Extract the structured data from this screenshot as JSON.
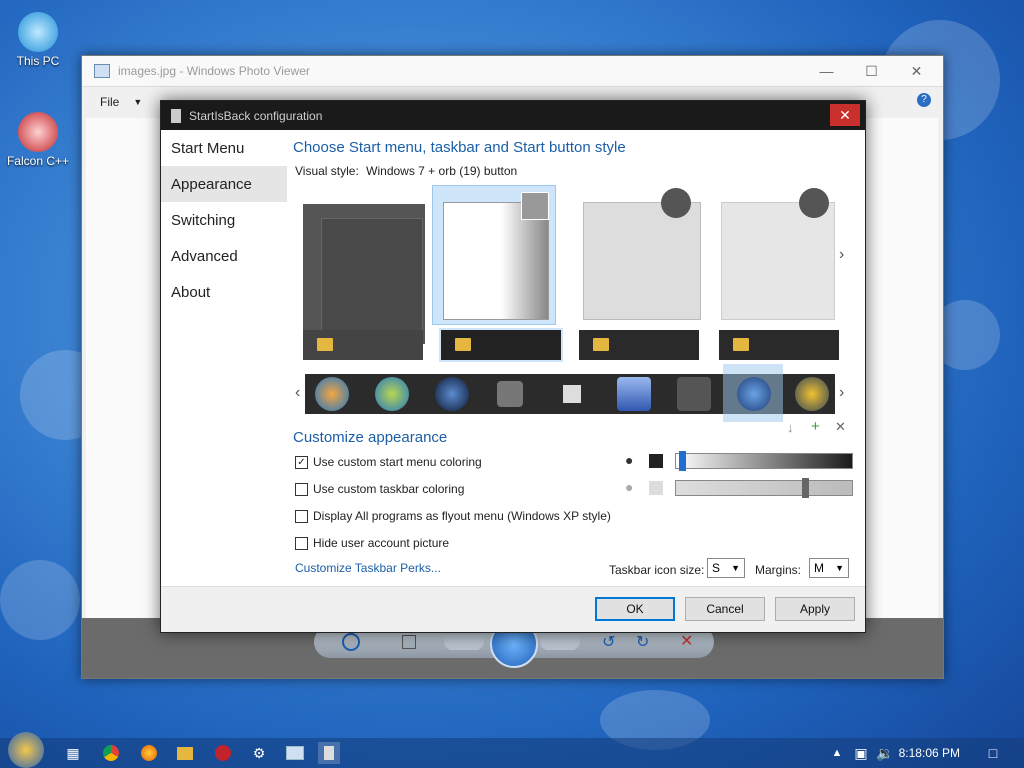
{
  "desktop": {
    "icons": [
      {
        "label": "This PC"
      },
      {
        "label": "Falcon C++"
      }
    ]
  },
  "photo_viewer": {
    "title": "images.jpg - Windows Photo Viewer",
    "menu": {
      "file": "File"
    }
  },
  "dialog": {
    "title": "StartIsBack configuration",
    "nav": [
      "Start Menu",
      "Appearance",
      "Switching",
      "Advanced",
      "About"
    ],
    "selected_nav": "Appearance",
    "header": "Choose Start menu, taskbar and Start button style",
    "visual_style_label": "Visual style:",
    "visual_style_value": "Windows 7 + orb (19) button",
    "customize_header": "Customize appearance",
    "checkboxes": [
      {
        "label": "Use custom start menu coloring",
        "checked": true
      },
      {
        "label": "Use custom taskbar coloring",
        "checked": false
      },
      {
        "label": "Display All programs as flyout menu (Windows XP style)",
        "checked": false
      },
      {
        "label": "Hide user account picture",
        "checked": false
      }
    ],
    "link": "Customize Taskbar Perks...",
    "taskbar_icon_size_label": "Taskbar icon size:",
    "taskbar_icon_size_value": "S",
    "margins_label": "Margins:",
    "margins_value": "M",
    "buttons": {
      "ok": "OK",
      "cancel": "Cancel",
      "apply": "Apply"
    },
    "slider1_level": 0.02,
    "slider2_level": 0.75
  },
  "taskbar": {
    "time": "8:18:06 PM"
  },
  "colors": {
    "accent": "#1c5fa8",
    "close_red": "#c9302c"
  }
}
